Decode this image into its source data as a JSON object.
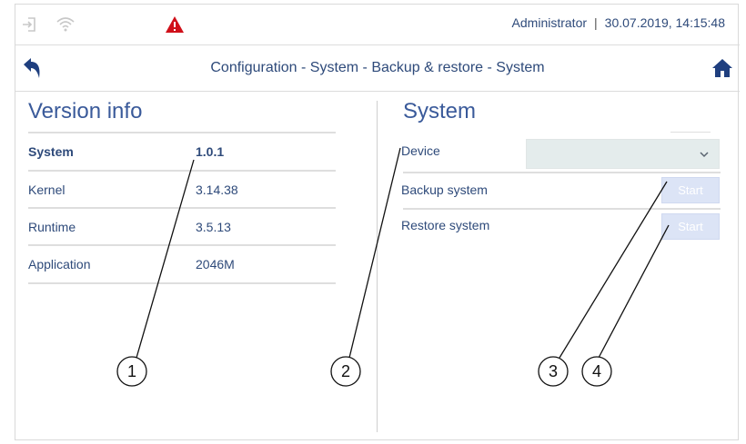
{
  "status": {
    "user": "Administrator",
    "separator": "|",
    "datetime": "30.07.2019, 14:15:48",
    "icons": [
      "login-icon",
      "wifi-icon",
      "warning-icon"
    ]
  },
  "header": {
    "title": "Configuration - System - Backup & restore - System",
    "icons": [
      "back-icon",
      "home-icon"
    ]
  },
  "version_info": {
    "heading": "Version info",
    "rows": [
      {
        "label": "System",
        "value": "1.0.1"
      },
      {
        "label": "Kernel",
        "value": "3.14.38"
      },
      {
        "label": "Runtime",
        "value": "3.5.13"
      },
      {
        "label": "Application",
        "value": "2046M"
      }
    ]
  },
  "system": {
    "heading": "System",
    "device_label": "Device",
    "device_value": "",
    "backup_label": "Backup system",
    "backup_button": "Start",
    "restore_label": "Restore system",
    "restore_button": "Start"
  },
  "callouts": [
    "1",
    "2",
    "3",
    "4"
  ],
  "colors": {
    "text": "#2e4a7a",
    "heading": "#3a5a9a",
    "warning": "#d0101a",
    "button_disabled": "#dce4f6",
    "select_bg": "#e4ecec",
    "icon_blue": "#1f3f7f"
  }
}
